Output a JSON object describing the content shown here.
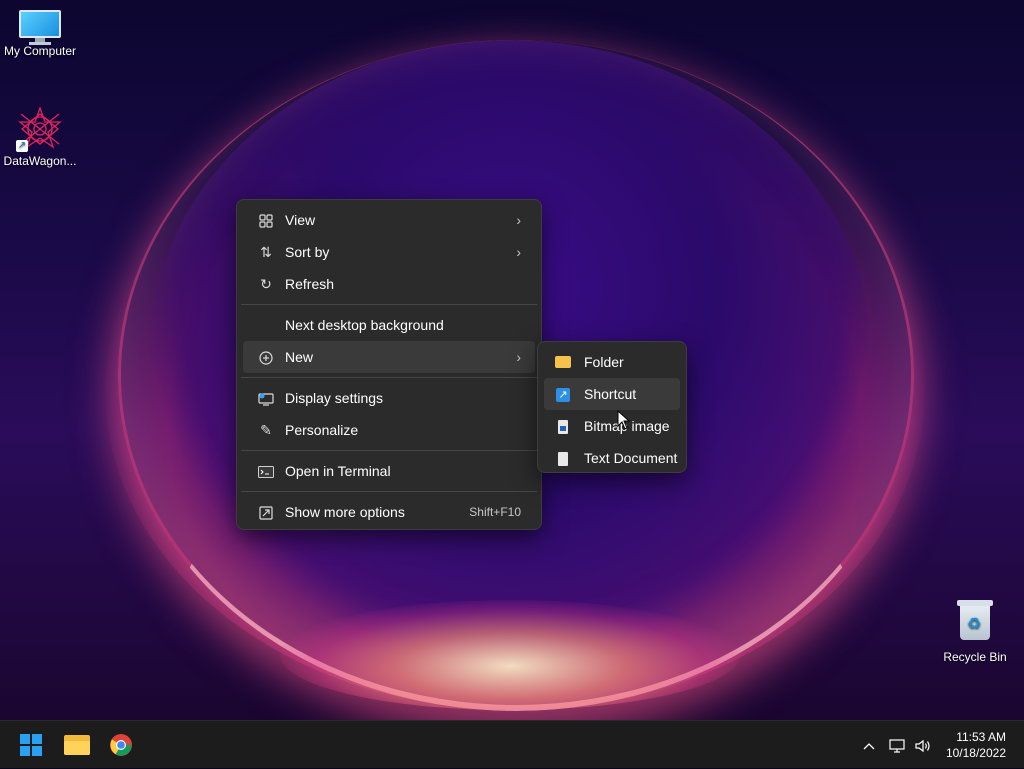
{
  "desktop": {
    "icons": [
      {
        "label": "My Computer",
        "icon": "monitor-icon"
      },
      {
        "label": "DataWagon...",
        "icon": "datawagon-app-icon"
      },
      {
        "label": "Recycle Bin",
        "icon": "recycle-bin-icon"
      }
    ]
  },
  "context_menu": {
    "items": [
      {
        "label": "View",
        "icon": "grid-icon",
        "submenu": true
      },
      {
        "label": "Sort by",
        "icon": "sort-icon",
        "submenu": true
      },
      {
        "label": "Refresh",
        "icon": "refresh-icon"
      },
      {
        "label": "Next desktop background"
      },
      {
        "label": "New",
        "icon": "plus-circle-icon",
        "submenu": true,
        "active": true
      },
      {
        "label": "Display settings",
        "icon": "display-settings-icon"
      },
      {
        "label": "Personalize",
        "icon": "brush-icon"
      },
      {
        "label": "Open in Terminal",
        "icon": "terminal-icon"
      },
      {
        "label": "Show more options",
        "icon": "more-options-icon",
        "shortcut": "Shift+F10"
      }
    ]
  },
  "new_submenu": {
    "items": [
      {
        "label": "Folder",
        "icon": "folder-icon"
      },
      {
        "label": "Shortcut",
        "icon": "shortcut-icon",
        "hovered": true
      },
      {
        "label": "Bitmap image",
        "icon": "bitmap-icon"
      },
      {
        "label": "Text Document",
        "icon": "text-document-icon"
      }
    ]
  },
  "taskbar": {
    "time": "11:53 AM",
    "date": "10/18/2022"
  },
  "colors": {
    "menu_bg": "#2b2b2b",
    "taskbar_bg": "#1c1c1c",
    "accent": "#2aa0f0"
  }
}
